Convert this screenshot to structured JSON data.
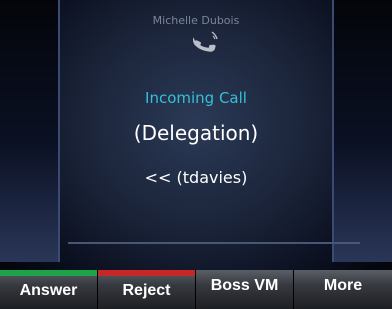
{
  "call": {
    "caller_name": "Michelle Dubois",
    "status": "Incoming Call",
    "group": "(Delegation)",
    "from": "<< (tdavies)"
  },
  "icons": {
    "handset": "ringing-handset-icon"
  },
  "softkeys": [
    {
      "label": "Answer",
      "indicator_color": "#1fa34a"
    },
    {
      "label": "Reject",
      "indicator_color": "#c62828"
    },
    {
      "label": "Boss VM",
      "indicator_color": ""
    },
    {
      "label": "More",
      "indicator_color": ""
    }
  ],
  "colors": {
    "status_text": "#34c0d8",
    "answer_indicator": "#1fa34a",
    "reject_indicator": "#c62828"
  }
}
